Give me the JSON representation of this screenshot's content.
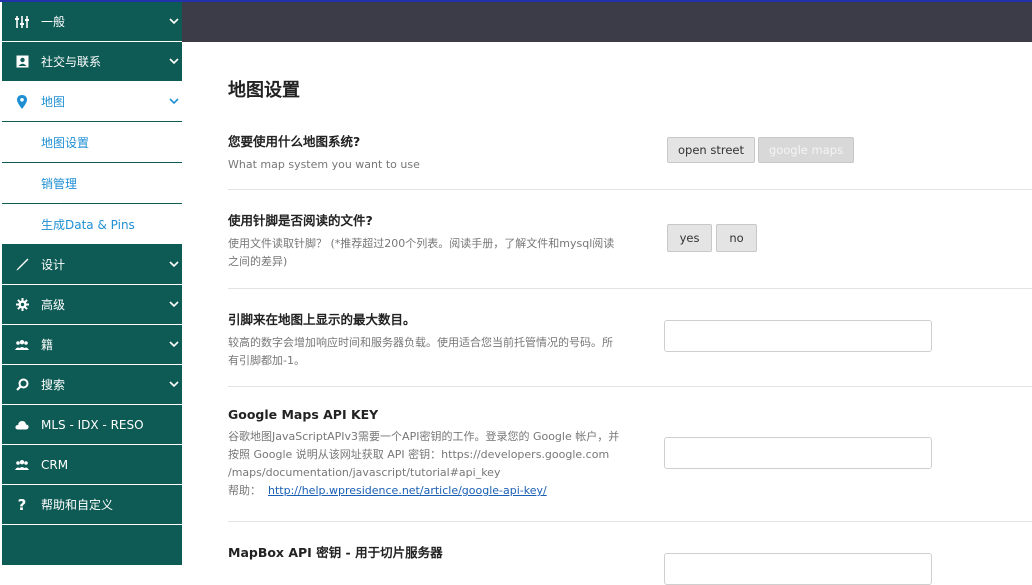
{
  "sidebar": {
    "items": [
      {
        "label": "一般",
        "icon": "sliders-icon"
      },
      {
        "label": "社交与联系",
        "icon": "contact-card-icon"
      },
      {
        "label": "地图",
        "icon": "map-pin-icon"
      },
      {
        "label": "设计",
        "icon": "brush-icon"
      },
      {
        "label": "高级",
        "icon": "gear-icon"
      },
      {
        "label": "籍",
        "icon": "users-icon"
      },
      {
        "label": "搜索",
        "icon": "search-icon"
      },
      {
        "label": "MLS - IDX - RESO",
        "icon": "cloud-icon"
      },
      {
        "label": "CRM",
        "icon": "users-icon"
      },
      {
        "label": "帮助和自定义",
        "icon": "question-icon"
      }
    ],
    "sub_items": [
      "地图设置",
      "销管理",
      "生成Data & Pins"
    ]
  },
  "main": {
    "title": "地图设置",
    "sections": [
      {
        "title": "您要使用什么地图系统?",
        "desc": "What map system you want to use",
        "buttons": [
          "open street",
          "google maps"
        ]
      },
      {
        "title": "使用针脚是否阅读的文件?",
        "desc_line1": "使用文件读取针脚？  (*推荐超过200个列表。阅读手册，了解文件和mysql阅读",
        "desc_line2": "之间的差异)",
        "buttons": [
          "yes",
          "no"
        ]
      },
      {
        "title": "引脚来在地图上显示的最大数目。",
        "desc_line1": "较高的数字会增加响应时间和服务器负载。使用适合您当前托管情况的号码。所",
        "desc_line2": "有引脚都加-1。",
        "input_value": ""
      },
      {
        "title": "Google Maps API KEY",
        "desc_line1": "谷歌地图JavaScriptAPIv3需要一个API密钥的工作。登录您的 Google 帐户，并",
        "desc_line2": "按照 Google 说明从该网址获取 API 密钥：https://developers.google.com",
        "desc_line3": "/maps/documentation/javascript/tutorial#api_key",
        "help_label": "帮助：",
        "help_link": "http://help.wpresidence.net/article/google-api-key/",
        "input_value": ""
      },
      {
        "title": "MapBox API 密钥 - 用于切片服务器"
      }
    ]
  },
  "colors": {
    "sidebar_bg": "#0e5a54",
    "topbar_bg": "#3c3c48",
    "accent": "#1f8fd4"
  }
}
